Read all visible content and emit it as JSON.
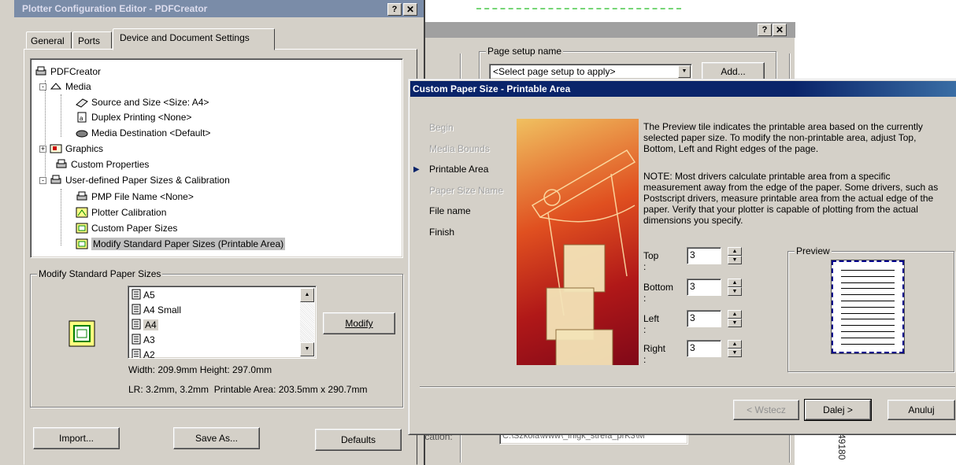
{
  "plotter": {
    "title": "Plotter Configuration Editor - PDFCreator",
    "tabs": [
      "General",
      "Ports",
      "Device and Document Settings"
    ],
    "tree": [
      {
        "label": "PDFCreator",
        "icon": "printer-icon"
      },
      {
        "label": "Media",
        "icon": "media-icon"
      },
      {
        "label": "Source and Size <Size: A4>",
        "icon": "paper-source-icon"
      },
      {
        "label": "Duplex Printing <None>",
        "icon": "duplex-icon"
      },
      {
        "label": "Media Destination <Default>",
        "icon": "media-destination-icon"
      },
      {
        "label": "Graphics",
        "icon": "graphics-icon"
      },
      {
        "label": "Custom Properties",
        "icon": "custom-properties-icon"
      },
      {
        "label": "User-defined Paper Sizes & Calibration",
        "icon": "paper-sizes-icon"
      },
      {
        "label": "PMP File Name <None>",
        "icon": "pmp-file-icon"
      },
      {
        "label": "Plotter Calibration",
        "icon": "calibration-icon"
      },
      {
        "label": "Custom Paper Sizes",
        "icon": "custom-paper-icon"
      },
      {
        "label": "Modify Standard Paper Sizes (Printable Area)",
        "icon": "modify-paper-icon"
      }
    ],
    "modify_group": {
      "label": "Modify Standard Paper Sizes",
      "list": [
        "A5",
        "A4 Small",
        "A4",
        "A3",
        "A2"
      ],
      "selected": "A4",
      "modify_button": "Modify",
      "size_info": "Width: 209.9mm Height: 297.0mm",
      "area_info": "LR: 3.2mm, 3.2mm  Printable Area: 203.5mm x 290.7mm"
    },
    "buttons": {
      "import": "Import...",
      "save_as": "Save As...",
      "defaults": "Defaults"
    }
  },
  "page_setup": {
    "group_label": "Page setup name",
    "select_value": "<Select page setup to apply>",
    "add_button": "Add...",
    "location_label": "Location:",
    "location_value": "C:\\Szkola\\www\\_inigk_strefa_prK3\\M"
  },
  "wizard": {
    "title": "Custom Paper Size - Printable Area",
    "steps": [
      {
        "label": "Begin",
        "state": "disabled"
      },
      {
        "label": "Media Bounds",
        "state": "disabled"
      },
      {
        "label": "Printable Area",
        "state": "current"
      },
      {
        "label": "Paper Size Name",
        "state": "disabled"
      },
      {
        "label": "File name",
        "state": "normal"
      },
      {
        "label": "Finish",
        "state": "normal"
      }
    ],
    "intro": "The Preview tile indicates the printable area based on the currently selected paper size. To modify the non-printable area, adjust Top, Bottom, Left and Right edges of the page.",
    "note": "NOTE: Most drivers calculate printable area from a specific measurement away from the edge of the paper. Some drivers, such as Postscript drivers, measure printable area from the actual edge of the paper. Verify that your plotter is capable of plotting from the actual dimensions you specify.",
    "fields": [
      {
        "label": "Top :",
        "value": "3"
      },
      {
        "label": "Bottom :",
        "value": "3"
      },
      {
        "label": "Left :",
        "value": "3"
      },
      {
        "label": "Right :",
        "value": "3"
      }
    ],
    "preview_label": "Preview",
    "buttons": {
      "back": "< Wstecz",
      "next": "Dalej >",
      "cancel": "Anuluj"
    }
  },
  "background_text": "k49180",
  "colors": {
    "title_bar": "#0a246a",
    "face": "#d4d0c8",
    "selection": "#0a246a",
    "current_arrow": "#0a246a"
  }
}
